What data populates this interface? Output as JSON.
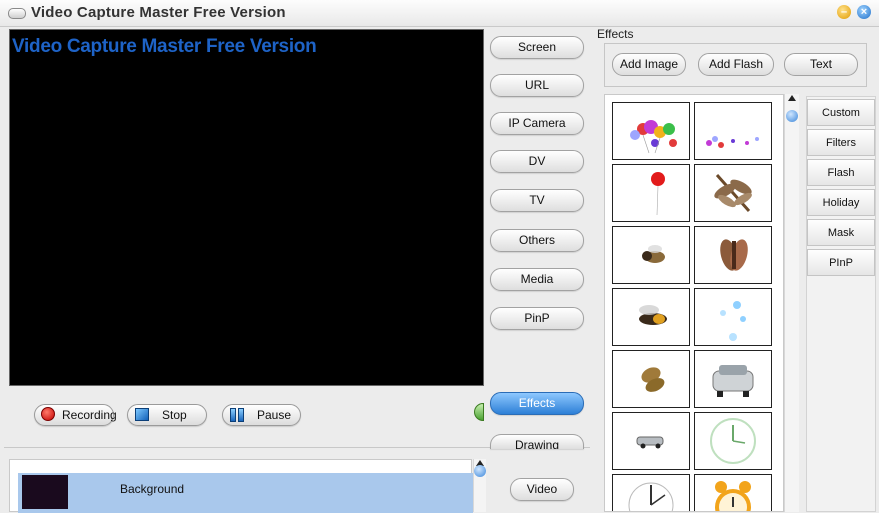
{
  "window": {
    "title": "Video Capture Master Free Version"
  },
  "preview": {
    "overlay_title": "Video Capture Master Free Version"
  },
  "controls": {
    "recording": "Recording",
    "stop": "Stop",
    "pause": "Pause"
  },
  "sources": {
    "items": [
      "Screen",
      "URL",
      "IP Camera",
      "DV",
      "TV",
      "Others",
      "Media",
      "PinP",
      "Effects",
      "Drawing",
      "Video"
    ],
    "active": "Effects"
  },
  "background_list": {
    "item_label": "Background"
  },
  "effects": {
    "section_label": "Effects",
    "add_image": "Add Image",
    "add_flash": "Add Flash",
    "text": "Text",
    "categories": [
      "Custom",
      "Filters",
      "Flash",
      "Holiday",
      "Mask",
      "PInP"
    ],
    "thumbnails": [
      "balloons-icon",
      "small-balloons-icon",
      "red-balloon-icon",
      "dragonfly-icon",
      "bee-icon",
      "moth-icon",
      "fly-icon",
      "bubbles-icon",
      "butterfly-icon",
      "car-front-icon",
      "car-side-icon",
      "clock-green-icon",
      "clock-hands-icon",
      "alarm-clock-icon"
    ]
  },
  "colors": {
    "accent": "#2d7fd6",
    "title_blue": "#1e63c7",
    "selection": "#a9c8ec"
  }
}
